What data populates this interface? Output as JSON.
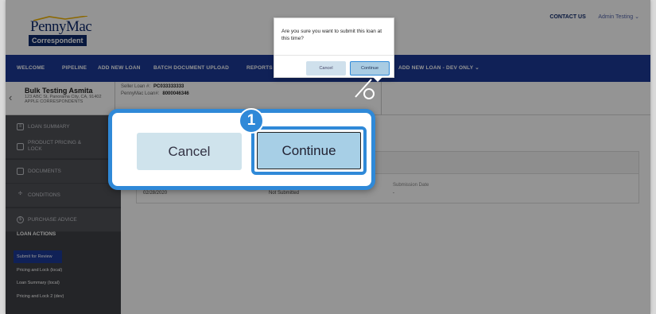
{
  "header": {
    "logo_primary": "PennyMac",
    "logo_secondary": "Correspondent",
    "contact_label": "CONTACT US",
    "user_label": "Admin Testing",
    "user_chevron": "chevron-down-icon"
  },
  "nav": {
    "items": [
      "WELCOME",
      "PIPELINE",
      "ADD NEW LOAN",
      "BATCH DOCUMENT UPLOAD",
      "REPORTS",
      "ADD NEW LOAN - DEV ONLY"
    ],
    "bg_color": "#1c3a96"
  },
  "loan": {
    "borrower_name": "Bulk Testing Asmita",
    "address": "123 ABC St, Panorama City, CA, 91402",
    "correspondent": "APPLE CORRESPONDENTS",
    "seller_loan_label": "Seller Loan #:",
    "seller_loan_value": "PC033333333",
    "pennymac_loan_label": "PennyMac Loan#:",
    "pennymac_loan_value": "8000046346"
  },
  "sidebar": {
    "items": [
      {
        "label": "LOAN SUMMARY",
        "icon": "list-icon"
      },
      {
        "label": "PRODUCT PRICING & LOCK",
        "icon": "lock-icon"
      },
      {
        "label": "DOCUMENTS",
        "icon": "document-icon"
      },
      {
        "label": "CONDITIONS",
        "icon": "conditions-icon"
      },
      {
        "label": "PURCHASE ADVICE",
        "icon": "dollar-icon"
      }
    ],
    "actions_title": "LOAN ACTIONS",
    "actions": [
      "Submit for Review",
      "Pricing and Lock (local)",
      "Loan Summary (local)",
      "Pricing and Lock 2 (dev)"
    ]
  },
  "table": {
    "submission_date_header": "Submission Date",
    "row": {
      "date": "02/28/2020",
      "status": "Not Submitted",
      "submission_date": "-"
    }
  },
  "dialog": {
    "message": "Are you sure you want to submit this loan at this time?",
    "cancel_label": "Cancel",
    "continue_label": "Continue"
  },
  "callout": {
    "step_number": "1",
    "cancel_label": "Cancel",
    "continue_label": "Continue",
    "accent_color": "#2f89d8"
  }
}
